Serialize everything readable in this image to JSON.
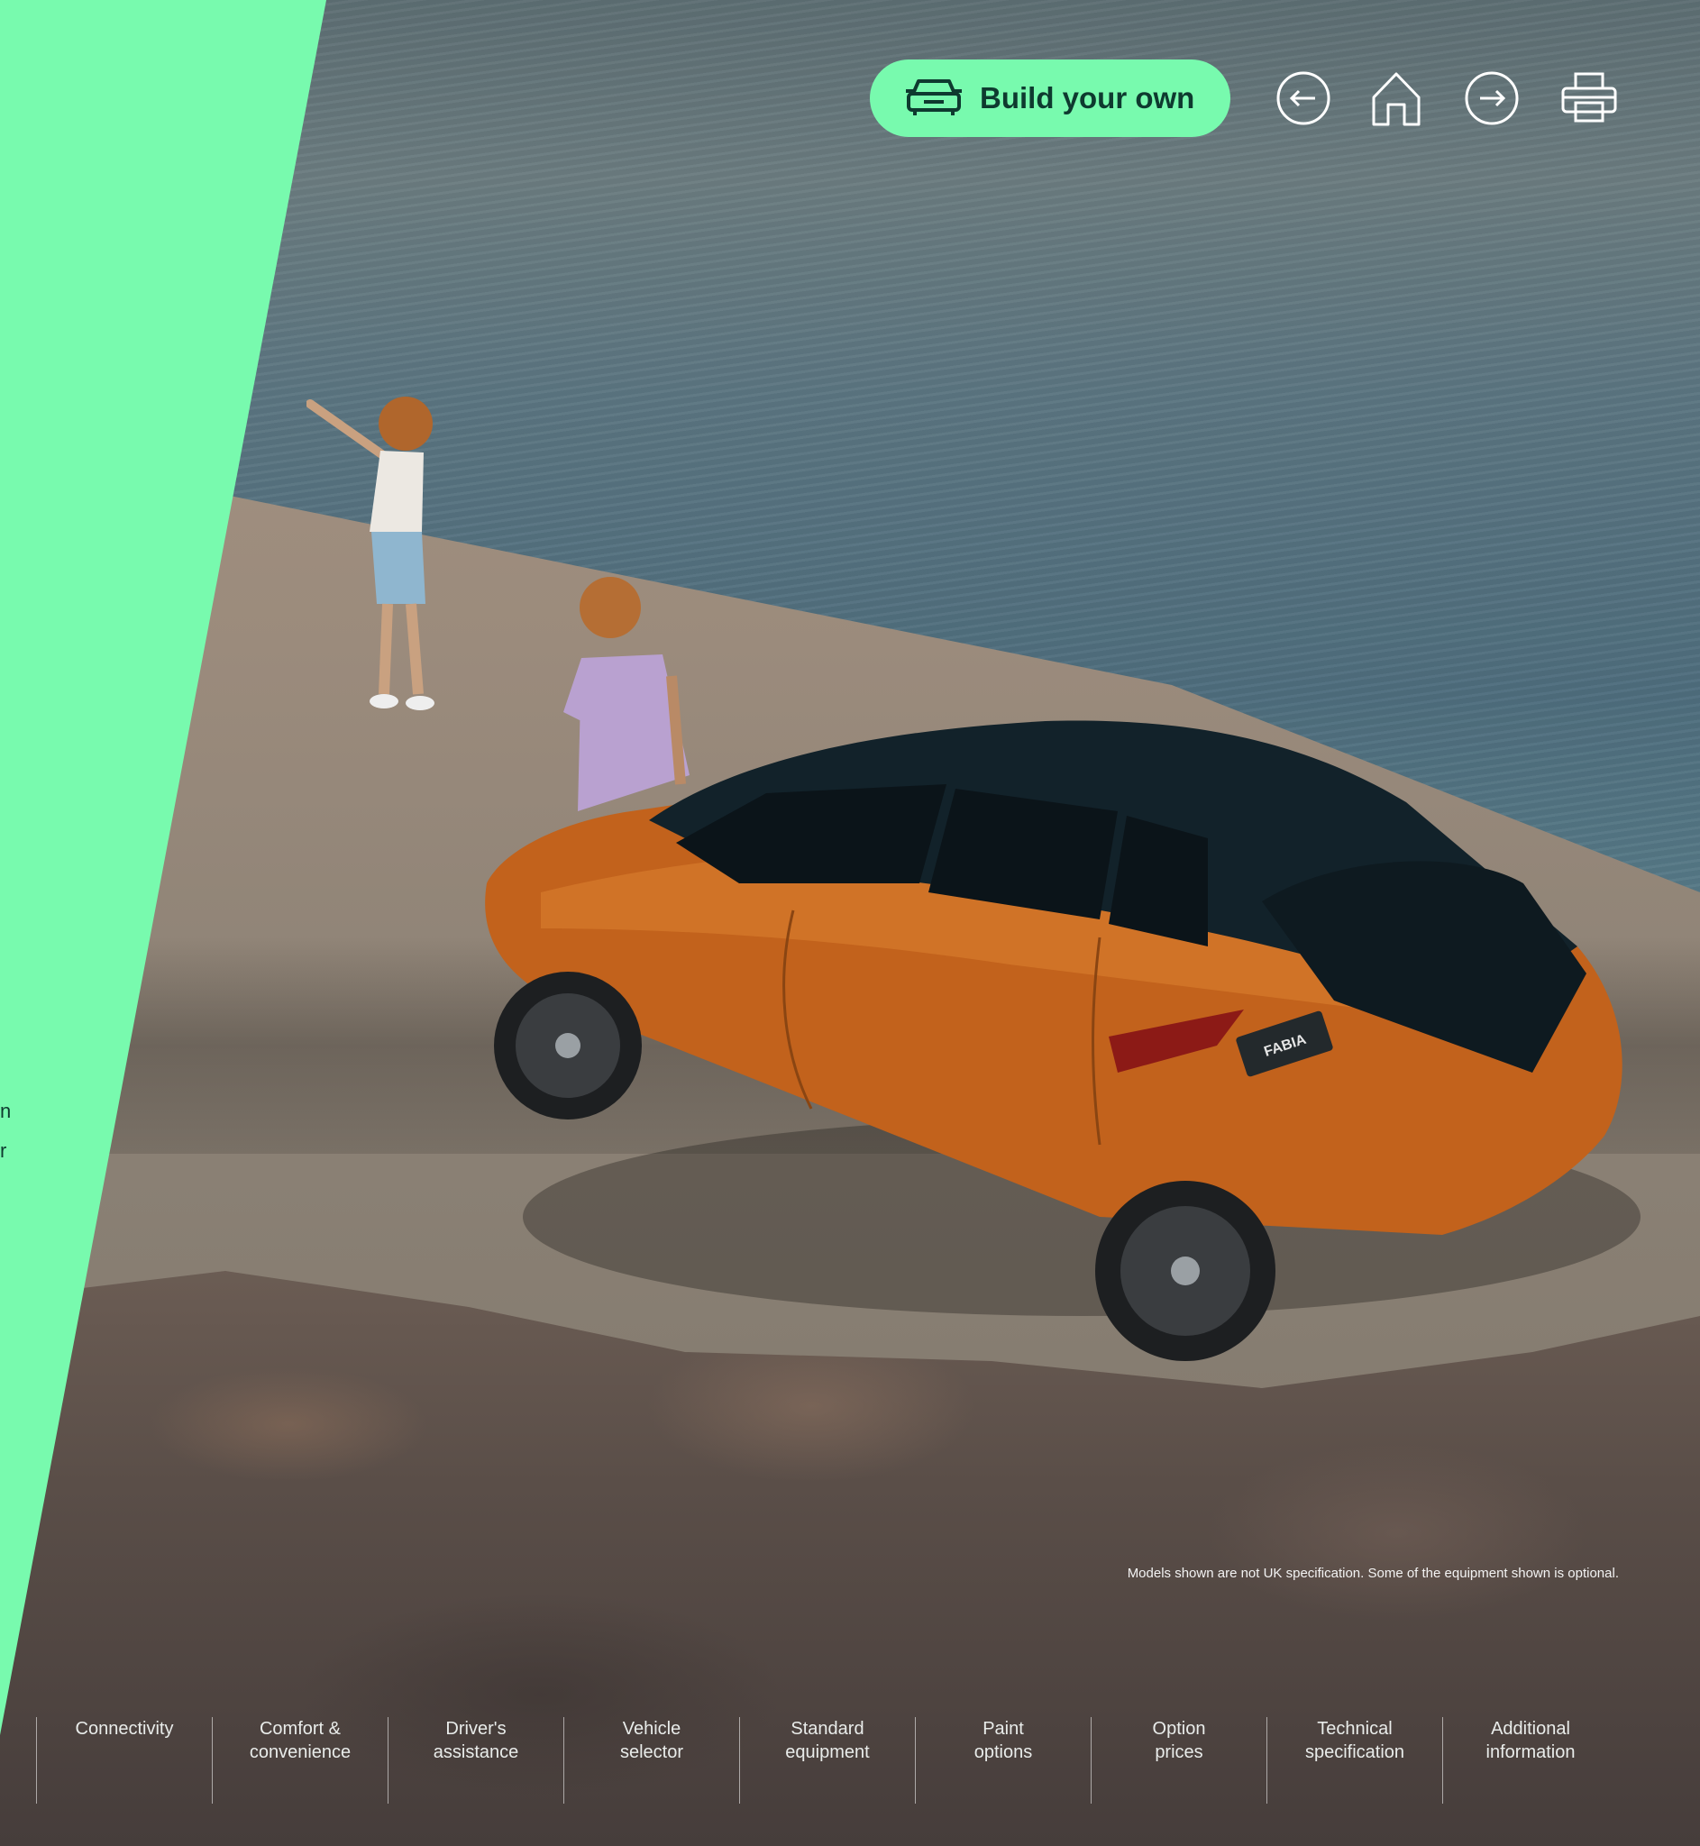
{
  "toolbar": {
    "build_label": "Build your own",
    "build_icon": "car-icon",
    "icons": [
      "back-arrow-icon",
      "home-icon",
      "forward-arrow-icon",
      "print-icon"
    ]
  },
  "side_panel": {
    "fragment_1": "n",
    "fragment_2": "r"
  },
  "car_badge": "FABIA",
  "disclaimer": "Models shown are not UK specification. Some of the equipment shown is optional.",
  "bottom_nav": {
    "items": [
      {
        "label": "Connectivity"
      },
      {
        "label": "Comfort &\nconvenience"
      },
      {
        "label": "Driver's\nassistance"
      },
      {
        "label": "Vehicle\nselector"
      },
      {
        "label": "Standard\nequipment"
      },
      {
        "label": "Paint\noptions"
      },
      {
        "label": "Option\nprices"
      },
      {
        "label": "Technical\nspecification"
      },
      {
        "label": "Additional\ninformation"
      }
    ]
  },
  "colors": {
    "accent_green": "#78faae",
    "dark_green": "#0e3a2f",
    "car_orange": "#c2621c"
  }
}
